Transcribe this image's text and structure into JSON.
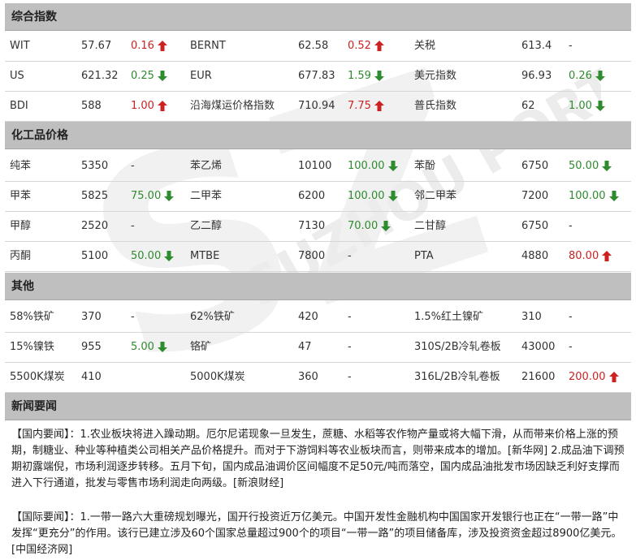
{
  "sections": {
    "composite": {
      "title": "综合指数",
      "rows": [
        [
          {
            "name": "WIT",
            "value": "57.67",
            "change": "0.16",
            "dir": "up"
          },
          {
            "name": "BERNT",
            "value": "62.58",
            "change": "0.52",
            "dir": "up"
          },
          {
            "name": "关税",
            "value": "613.4",
            "change": "-",
            "dir": "none"
          }
        ],
        [
          {
            "name": "US",
            "value": "621.32",
            "change": "0.25",
            "dir": "down"
          },
          {
            "name": "EUR",
            "value": "677.83",
            "change": "1.59",
            "dir": "down"
          },
          {
            "name": "美元指数",
            "value": "96.93",
            "change": "0.26",
            "dir": "down"
          }
        ],
        [
          {
            "name": "BDI",
            "value": "588",
            "change": "1.00",
            "dir": "up"
          },
          {
            "name": "沿海煤运价格指数",
            "value": "710.94",
            "change": "7.75",
            "dir": "up"
          },
          {
            "name": "普氏指数",
            "value": "62",
            "change": "1.00",
            "dir": "down"
          }
        ]
      ]
    },
    "chemicals": {
      "title": "化工品价格",
      "rows": [
        [
          {
            "name": "纯苯",
            "value": "5350",
            "change": "-",
            "dir": "none"
          },
          {
            "name": "苯乙烯",
            "value": "10100",
            "change": "100.00",
            "dir": "down"
          },
          {
            "name": "苯酚",
            "value": "6750",
            "change": "50.00",
            "dir": "down"
          }
        ],
        [
          {
            "name": "甲苯",
            "value": "5825",
            "change": "75.00",
            "dir": "down"
          },
          {
            "name": "二甲苯",
            "value": "6200",
            "change": "100.00",
            "dir": "down"
          },
          {
            "name": "邻二甲苯",
            "value": "7200",
            "change": "100.00",
            "dir": "down"
          }
        ],
        [
          {
            "name": "甲醇",
            "value": "2520",
            "change": "-",
            "dir": "none"
          },
          {
            "name": "乙二醇",
            "value": "7130",
            "change": "70.00",
            "dir": "down"
          },
          {
            "name": "二甘醇",
            "value": "6750",
            "change": "-",
            "dir": "none"
          }
        ],
        [
          {
            "name": "丙酮",
            "value": "5100",
            "change": "50.00",
            "dir": "down"
          },
          {
            "name": "MTBE",
            "value": "7800",
            "change": "-",
            "dir": "none"
          },
          {
            "name": "PTA",
            "value": "4880",
            "change": "80.00",
            "dir": "up"
          }
        ]
      ]
    },
    "others": {
      "title": "其他",
      "rows": [
        [
          {
            "name": "58%铁矿",
            "value": "370",
            "change": "-",
            "dir": "none"
          },
          {
            "name": "62%铁矿",
            "value": "420",
            "change": "-",
            "dir": "none"
          },
          {
            "name": "1.5%红土镍矿",
            "value": "310",
            "change": "-",
            "dir": "none"
          }
        ],
        [
          {
            "name": "15%镍铁",
            "value": "955",
            "change": "5.00",
            "dir": "down"
          },
          {
            "name": "铬矿",
            "value": "47",
            "change": "-",
            "dir": "none"
          },
          {
            "name": "310S/2B冷轧卷板",
            "value": "43000",
            "change": "-",
            "dir": "none"
          }
        ],
        [
          {
            "name": "5500K煤炭",
            "value": "410",
            "change": "",
            "dir": "none"
          },
          {
            "name": "5000K煤炭",
            "value": "360",
            "change": "-",
            "dir": "none"
          },
          {
            "name": "316L/2B冷轧卷板",
            "value": "21600",
            "change": "200.00",
            "dir": "up"
          }
        ]
      ]
    },
    "news": {
      "title": "新闻要闻",
      "domestic": "【国内要闻】：1.农业板块将进入躁动期。厄尔尼诺现象一旦发生，蔗糖、水稻等农作物产量或将大幅下滑，从而带来价格上涨的预期，制糖业、种业等种植类公司相关产品价格提升。而对于下游饲料等农业板块而言，则带来成本的增加。[新华网] 2.成品油下调预期初露端倪，市场利润逐步转移。五月下旬，国内成品油调价区间幅度不足50元/吨而落空，国内成品油批发市场因缺乏利好支撑而进入下行通道，批发与零售市场利润走向两级。[新浪财经]",
      "international": "【国际要闻】：1.一带一路六大重磅规划曝光，国开行投资近万亿美元。中国开发性金融机构中国国家开发银行也正在“一带一路”中发挥“更充分”的作用。该行已建立涉及60个国家总量超过900个的项目“一带一路”的项目储备库，涉及投资资金超过8900亿美元。[中国经济网]"
    }
  },
  "colors": {
    "header_bg": "#bfbfbf",
    "up": "#cc2222",
    "down": "#2e8b2e",
    "watermark": "#e8e8e8"
  },
  "icons": {
    "up": "arrow-up-icon",
    "down": "arrow-down-icon"
  },
  "watermark": {
    "mark": "SZ",
    "text": "SUZHOU PORT"
  }
}
